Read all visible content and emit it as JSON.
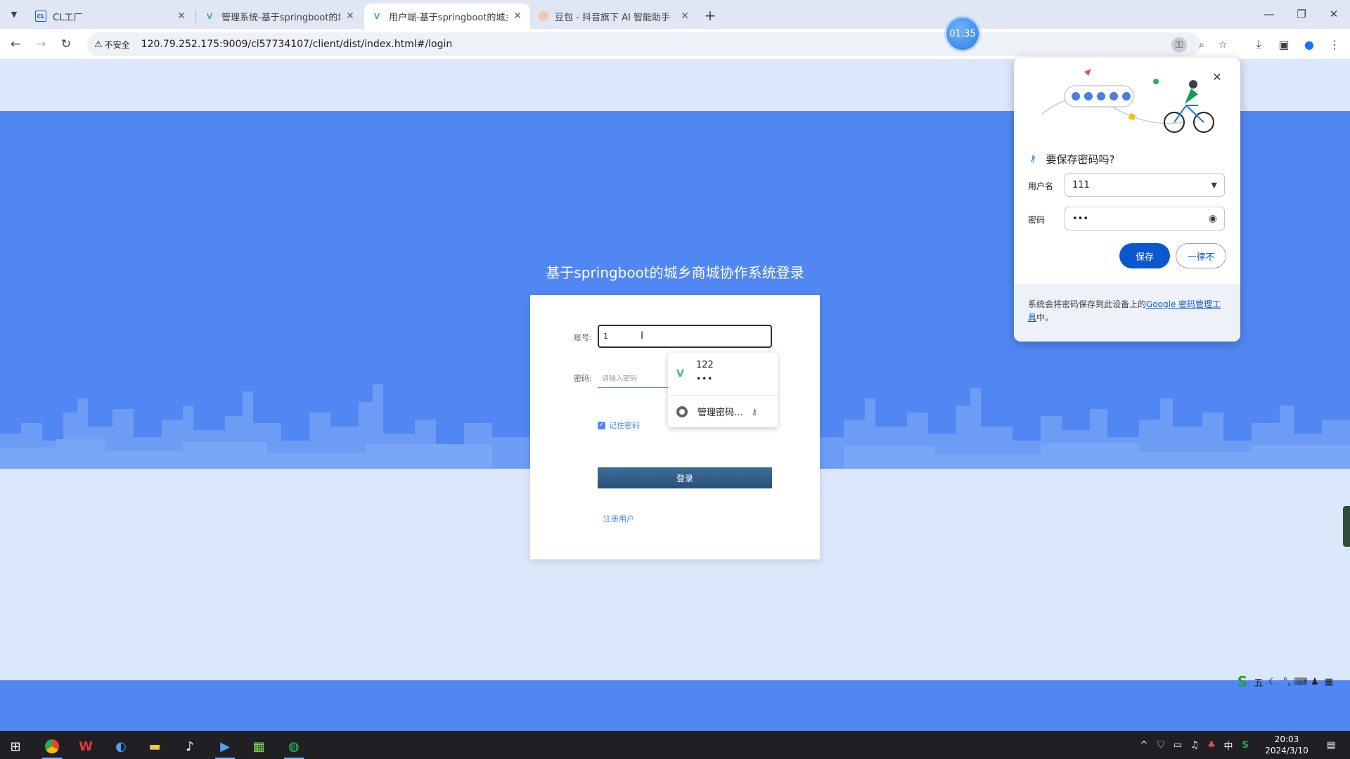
{
  "browser": {
    "tabs": [
      {
        "title": "CL工厂",
        "favicon": "cl-icon",
        "active": false
      },
      {
        "title": "管理系统-基于springboot的城乡",
        "favicon": "vue-icon",
        "active": false
      },
      {
        "title": "用户端-基于springboot的城乡",
        "favicon": "vue-icon",
        "active": true
      },
      {
        "title": "豆包 - 抖音旗下 AI 智能助手",
        "favicon": "doubao-icon",
        "active": false
      }
    ],
    "omnibox": {
      "security_label": "不安全",
      "url": "120.79.252.175:9009/cl57734107/client/dist/index.html#/login"
    }
  },
  "timer": {
    "value": "01:35"
  },
  "login": {
    "title": "基于springboot的城乡商城协作系统登录",
    "account_label": "账号:",
    "account_value": "1",
    "password_label": "密码:",
    "password_placeholder": "请输入密码",
    "remember_label": "记住密码",
    "remember_checked": true,
    "login_button": "登录",
    "register_link": "注册用户"
  },
  "autofill": {
    "username": "122",
    "password_mask": "•••",
    "manage_label": "管理密码..."
  },
  "save_password": {
    "title": "要保存密码吗?",
    "username_label": "用户名",
    "username_value": "111",
    "password_label": "密码",
    "password_mask": "•••",
    "save_button": "保存",
    "never_button": "一律不",
    "footer_text": "系统会将密码保存到此设备上的",
    "footer_link": "Google 密码管理工具",
    "footer_suffix": "中。"
  },
  "ime": {
    "mode": "五"
  },
  "taskbar": {
    "time": "20:03",
    "date": "2024/3/10",
    "ime_indicator": "中"
  },
  "colors": {
    "hero_blue": "#5087f3",
    "page_bg": "#dbe7fb",
    "save_blue": "#0b57d0"
  }
}
